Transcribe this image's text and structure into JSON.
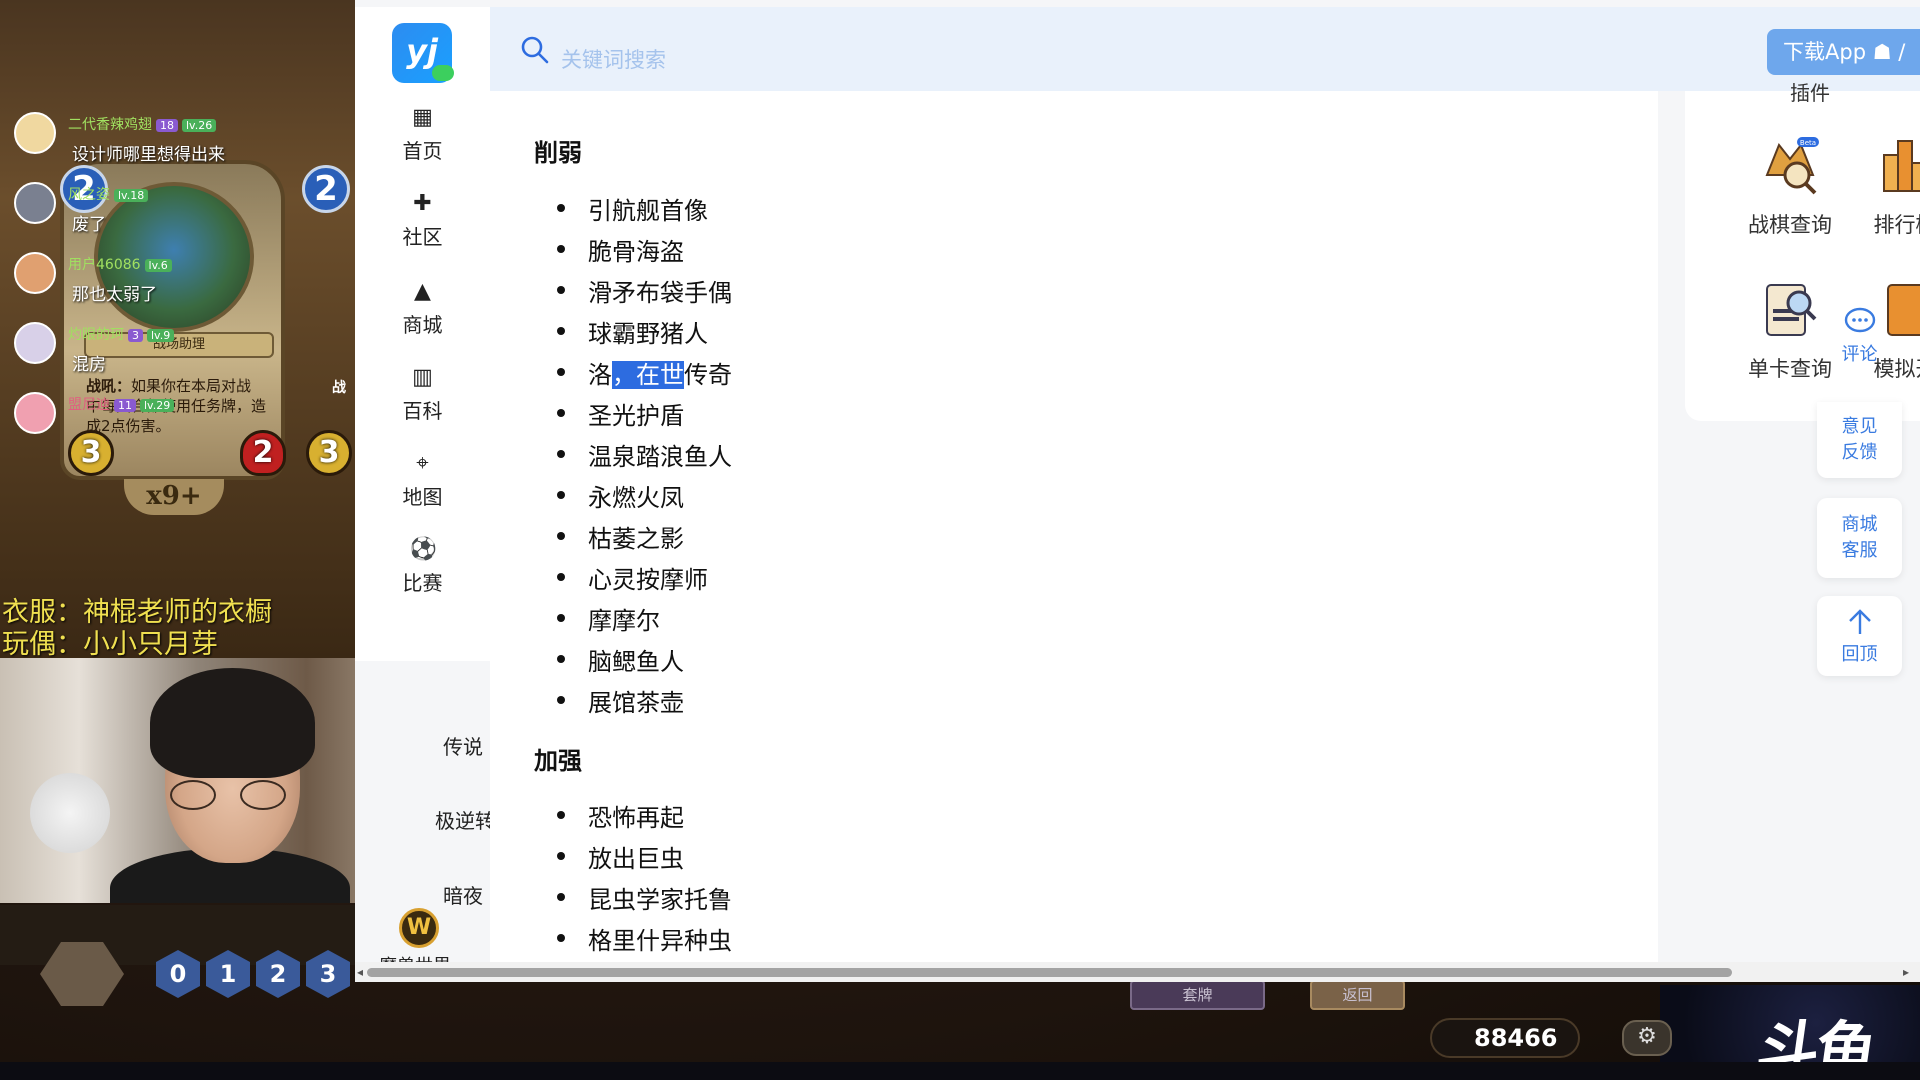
{
  "stream": {
    "danmaku": [
      {
        "user": "二代香辣鸡翅",
        "badge": "18",
        "level": "lv.26",
        "message": "设计师哪里想得出来"
      },
      {
        "user": "风之姿",
        "badge": "",
        "level": "lv.18",
        "message": "废了"
      },
      {
        "user": "用户46086",
        "badge": "",
        "level": "lv.6",
        "message": "那也太弱了"
      },
      {
        "user": "灼眼的珂",
        "badge": "3",
        "level": "lv.9",
        "message": "混房"
      },
      {
        "user": "盟尼迪",
        "badge": "11",
        "level": "lv.29",
        "message": ""
      }
    ],
    "overlay_clothes": "衣服：神棍老师的衣橱",
    "overlay_toy": "玩偶：小小只月芽",
    "card": {
      "banner": "战场助理",
      "text_keyword": "战吼：",
      "text_body": "如果你在本局对战中每回合都使用任务牌，造成2点伤害。",
      "mana": "2",
      "attack": "3",
      "health": "2",
      "count": "x9+"
    },
    "second_card_mana": "2",
    "second_card_attack": "3",
    "second_card_text": "战",
    "mana_gems": [
      "0",
      "1",
      "2",
      "3"
    ],
    "bottom_tab_deck": "套牌",
    "bottom_tab_back": "返回",
    "gold": "88466",
    "platform_logo": "斗鱼",
    "gear_icon": "gear-icon"
  },
  "site": {
    "logo_text": "yj",
    "search_placeholder": "关键词搜索",
    "download_label": "下载App",
    "header_partial_right": "插件",
    "nav": [
      {
        "label": "首页",
        "icon": "home-icon"
      },
      {
        "label": "社区",
        "icon": "community-icon"
      },
      {
        "label": "商城",
        "icon": "shop-icon"
      },
      {
        "label": "百科",
        "icon": "wiki-icon"
      },
      {
        "label": "地图",
        "icon": "map-icon"
      },
      {
        "label": "比赛",
        "icon": "match-icon"
      }
    ],
    "nav_partial": [
      "传说",
      "极逆转",
      "暗夜",
      "魔兽世界"
    ],
    "sections": [
      {
        "heading": "削弱",
        "items": [
          "引航舰首像",
          "脆骨海盗",
          "滑矛布袋手偶",
          "球霸野猪人",
          "洛，在世传奇",
          "圣光护盾",
          "温泉踏浪鱼人",
          "永燃火凤",
          "枯萎之影",
          "心灵按摩师",
          "摩摩尔",
          "脑鳃鱼人",
          "展馆茶壶"
        ]
      },
      {
        "heading": "加强",
        "items": [
          "恐怖再起",
          "放出巨虫",
          "昆虫学家托鲁",
          "格里什异种虫"
        ]
      }
    ],
    "highlighted_item": {
      "before": "洛",
      "selected": "，在世",
      "after": "传奇"
    },
    "tools": [
      {
        "label": "战棋查询",
        "icon": "battleground-query-icon",
        "tag": "Beta"
      },
      {
        "label": "排行榜",
        "icon": "leaderboard-icon"
      },
      {
        "label": "单卡查询",
        "icon": "card-query-icon"
      },
      {
        "label": "模拟开",
        "icon": "pack-open-icon"
      }
    ],
    "float_buttons": [
      {
        "label": "评论",
        "icon": "comment-icon"
      },
      {
        "label": "意见反馈",
        "line1": "意见",
        "line2": "反馈"
      },
      {
        "label": "商城客服",
        "line1": "商城",
        "line2": "客服"
      },
      {
        "label": "回顶",
        "icon": "arrow-up-icon"
      }
    ]
  }
}
